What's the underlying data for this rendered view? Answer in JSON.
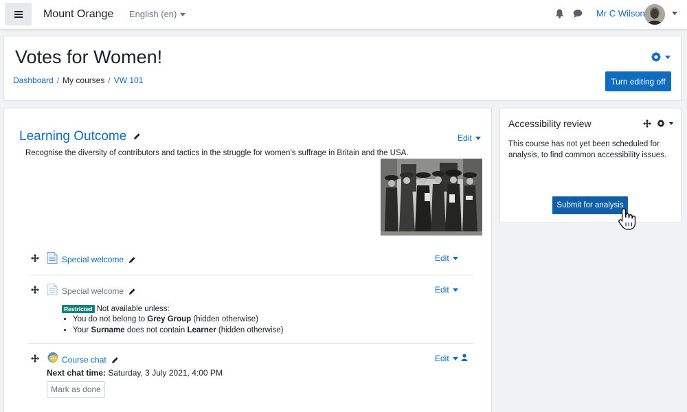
{
  "navbar": {
    "site_name": "Mount Orange",
    "language": "English (en)",
    "user_name": "Mr C Wilson",
    "icons": [
      "menu-icon",
      "bell-icon",
      "message-icon",
      "avatar"
    ]
  },
  "header": {
    "title": "Votes for Women!",
    "breadcrumb": [
      "Dashboard",
      "My courses",
      "VW 101"
    ],
    "editing_button": "Turn editing off"
  },
  "section": {
    "title": "Learning Outcome",
    "edit_label": "Edit",
    "summary": "Recognise the diversity of contributors and tactics in the struggle for women’s suffrage in Britain and the USA.",
    "image": "suffragette-group-photo"
  },
  "activities": [
    {
      "name": "Special welcome",
      "edit_label": "Edit",
      "icon": "page-icon"
    },
    {
      "name": "Special welcome",
      "edit_label": "Edit",
      "icon": "page-icon",
      "restriction": {
        "badge": "Restricted",
        "intro": "Not available unless:",
        "rule1_prefix": "You do not belong to",
        "rule1_bold": "Grey Group",
        "rule1_suffix": "(hidden otherwise)",
        "rule2_prefix": "Your",
        "rule2_bold1": "Surname",
        "rule2_middle": "does not contain",
        "rule2_bold2": "Learner",
        "rule2_suffix": "(hidden otherwise)"
      }
    },
    {
      "name": "Course chat",
      "edit_label": "Edit",
      "icon": "chat-icon",
      "next_chat_label": "Next chat time:",
      "next_chat_value": "Saturday, 3 July 2021, 4:00 PM",
      "mark_done": "Mark as done"
    }
  ],
  "block": {
    "title": "Accessibility review",
    "text": "This course has not yet been scheduled for analysis, to find common accessibility issues.",
    "button": "Submit for analysis"
  },
  "colors": {
    "primary": "#0f6cbf",
    "button_dark": "#0f5ea8",
    "restricted_badge": "#17827a"
  }
}
